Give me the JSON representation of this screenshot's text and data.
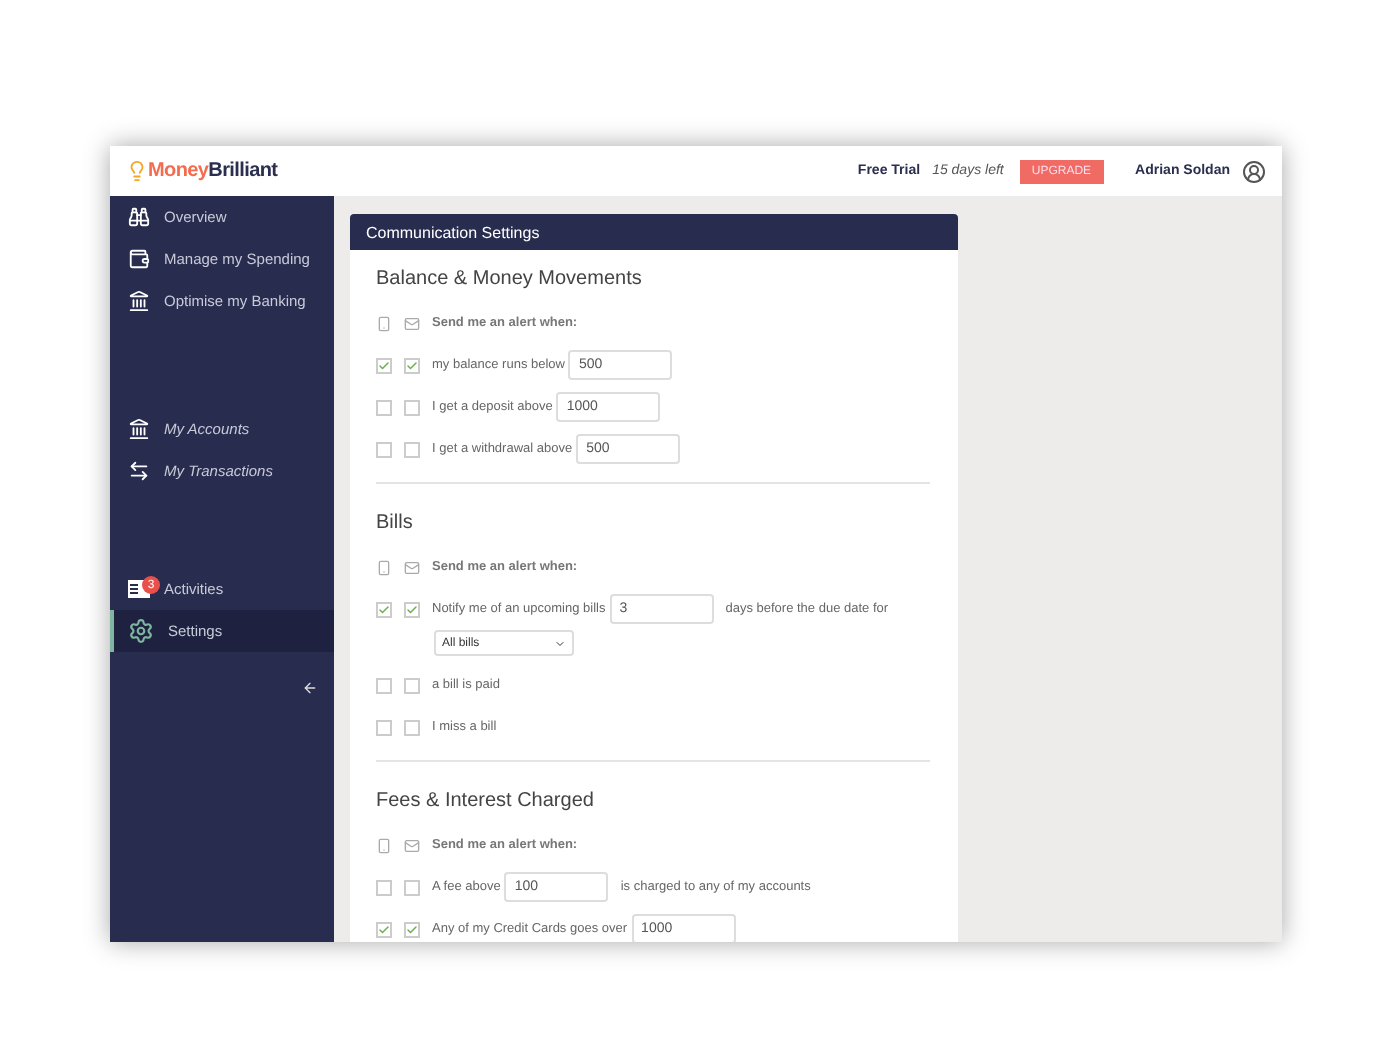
{
  "header": {
    "logo": {
      "first": "Money",
      "second": "Brilliant"
    },
    "trial_label": "Free Trial",
    "trial_days": "15 days left",
    "upgrade_button": "UPGRADE",
    "user_name": "Adrian Soldan"
  },
  "sidebar": {
    "sections": [
      {
        "kind": "main",
        "items": [
          {
            "label": "Overview",
            "selected": false
          },
          {
            "label": "Manage my Spending",
            "selected": false
          },
          {
            "label": "Optimise my Banking",
            "selected": false
          }
        ]
      },
      {
        "kind": "accounts",
        "items": [
          {
            "label": "My Accounts",
            "selected": false
          },
          {
            "label": "My Transactions",
            "selected": false
          }
        ]
      },
      {
        "kind": "bottom",
        "items": [
          {
            "label": "Activities",
            "badge": "3",
            "selected": false
          },
          {
            "label": "Settings",
            "selected": true
          }
        ]
      }
    ]
  },
  "panel": {
    "title": "Communication Settings",
    "sections": [
      {
        "title": "Balance & Money Movements",
        "alert_heading": "Send me an alert when:",
        "rows": [
          {
            "kind": "threshold",
            "sms_checked": true,
            "email_checked": true,
            "text": "my balance runs below",
            "value": "500"
          },
          {
            "kind": "threshold",
            "sms_checked": false,
            "email_checked": false,
            "text": "I get a deposit above",
            "value": "1000"
          },
          {
            "kind": "threshold",
            "sms_checked": false,
            "email_checked": false,
            "text": "I get a withdrawal above",
            "value": "500"
          }
        ]
      },
      {
        "title": "Bills",
        "alert_heading": "Send me an alert when:",
        "rows": [
          {
            "kind": "threshold",
            "sms_checked": true,
            "email_checked": true,
            "text": "Notify me of an upcoming bills",
            "value": "3",
            "suffix": "days before the due date for",
            "select": "All bills"
          },
          {
            "kind": "simple",
            "sms_checked": false,
            "email_checked": false,
            "text": "a bill is paid"
          },
          {
            "kind": "simple",
            "sms_checked": false,
            "email_checked": false,
            "text": "I miss a bill"
          }
        ]
      },
      {
        "title": "Fees & Interest Charged",
        "alert_heading": "Send me an alert when:",
        "rows": [
          {
            "kind": "threshold",
            "sms_checked": false,
            "email_checked": false,
            "text": "A fee above",
            "value": "100",
            "suffix": "is charged to any of my accounts"
          },
          {
            "kind": "threshold",
            "sms_checked": true,
            "email_checked": true,
            "text": "Any of my Credit Cards goes over",
            "value": "1000"
          }
        ]
      }
    ]
  }
}
